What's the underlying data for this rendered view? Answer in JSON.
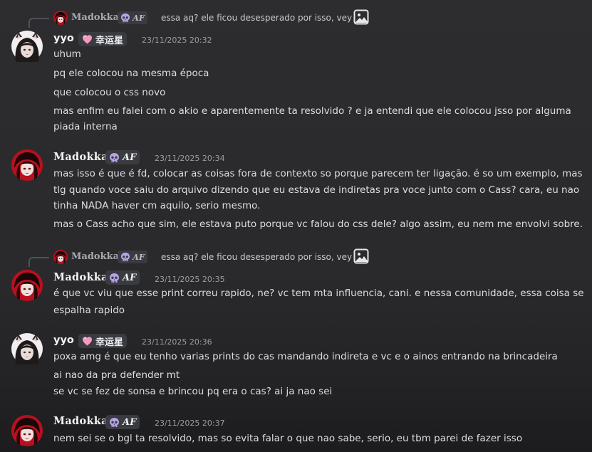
{
  "users": {
    "madokka": {
      "name": "Madokka",
      "tag": "AF"
    },
    "yyo": {
      "name": "yyo",
      "tag": "幸运星"
    }
  },
  "colors": {
    "madokka_avatar": "#b8101f",
    "yyo_avatar": "#f0eeee",
    "pink_heart": "#f49ac1",
    "skull_purple": "#b7a3e6"
  },
  "reply_preview": {
    "text": "essa aq? ele ficou desesperado por isso, vey",
    "icon": "image-icon"
  },
  "messages": [
    {
      "author": "yyo",
      "timestamp": "23/11/2025 20:32",
      "lines": [
        "uhum",
        "pq ele colocou na mesma época",
        "que colocou o css novo",
        "mas enfim eu falei com o akio e aparentemente ta resolvido ? e ja entendi que ele colocou jsso por alguma",
        "piada interna"
      ]
    },
    {
      "author": "madokka",
      "timestamp": "23/11/2025 20:34",
      "lines": [
        "mas isso é que é fd, colocar as coisas fora de contexto so porque parecem ter ligação. é so um exemplo, mas",
        "tlg quando voce saiu do arquivo dizendo que eu estava de indiretas pra voce junto com o Cass? cara, eu nao",
        "tinha NADA haver cm aquilo, serio mesmo.",
        "mas o Cass acho que sim, ele estava puto porque vc falou do css dele? algo assim, eu nem me envolvi sobre."
      ]
    },
    {
      "author": "madokka",
      "timestamp": "23/11/2025 20:35",
      "lines": [
        "é que vc viu que esse print correu rapido, ne? vc tem mta influencia, cani. e nessa comunidade, essa coisa se",
        "espalha rapido"
      ]
    },
    {
      "author": "yyo",
      "timestamp": "23/11/2025 20:36",
      "lines": [
        "poxa amg é que eu tenho varias prints do cas mandando indireta e vc e o ainos entrando na brincadeira",
        "ai nao da pra defender mt",
        "se vc se fez de sonsa e brincou pq era o cas? ai ja nao sei"
      ]
    },
    {
      "author": "madokka",
      "timestamp": "23/11/2025 20:37",
      "lines": [
        "nem sei se o bgl ta resolvido, mas so evita falar o que nao sabe, serio, eu tbm parei de fazer isso"
      ]
    }
  ]
}
